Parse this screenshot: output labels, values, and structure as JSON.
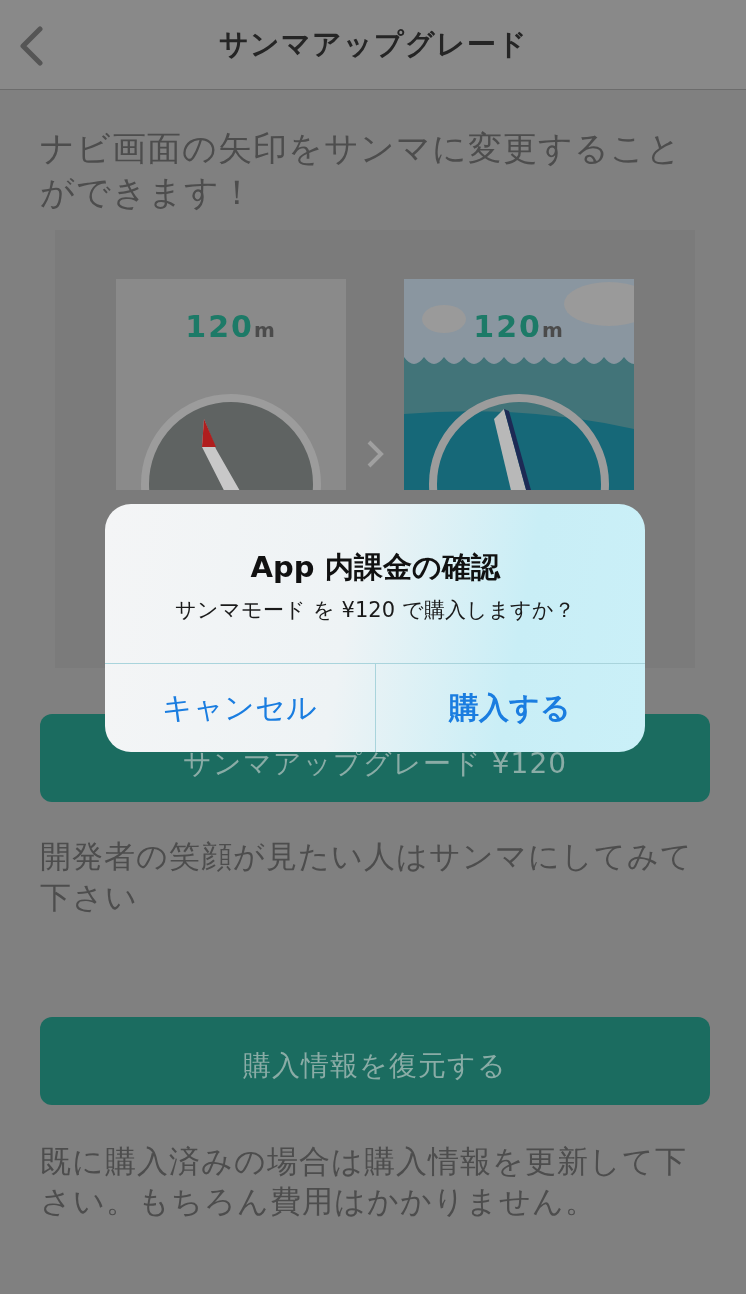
{
  "nav": {
    "title": "サンマアップグレード"
  },
  "intro": "ナビ画面の矢印をサンマに変更することができます！",
  "preview": {
    "cards": [
      {
        "kind": "compass",
        "distance": "120",
        "unit": "m"
      },
      {
        "kind": "sanma",
        "distance": "120",
        "unit": "m"
      }
    ]
  },
  "purchase_button": "サンマアップグレード ¥120",
  "note": "開発者の笑顔が見たい人はサンマにしてみて下さい",
  "restore_button": "購入情報を復元する",
  "restore_note": "既に購入済みの場合は購入情報を更新して下さい。もちろん費用はかかりません。",
  "alert": {
    "title": "App 内課金の確認",
    "message": "サンマモード を ¥120 で購入しますか？",
    "buttons": [
      {
        "label": "キャンセル",
        "kind": "cancel"
      },
      {
        "label": "購入する",
        "kind": "confirm"
      }
    ]
  }
}
